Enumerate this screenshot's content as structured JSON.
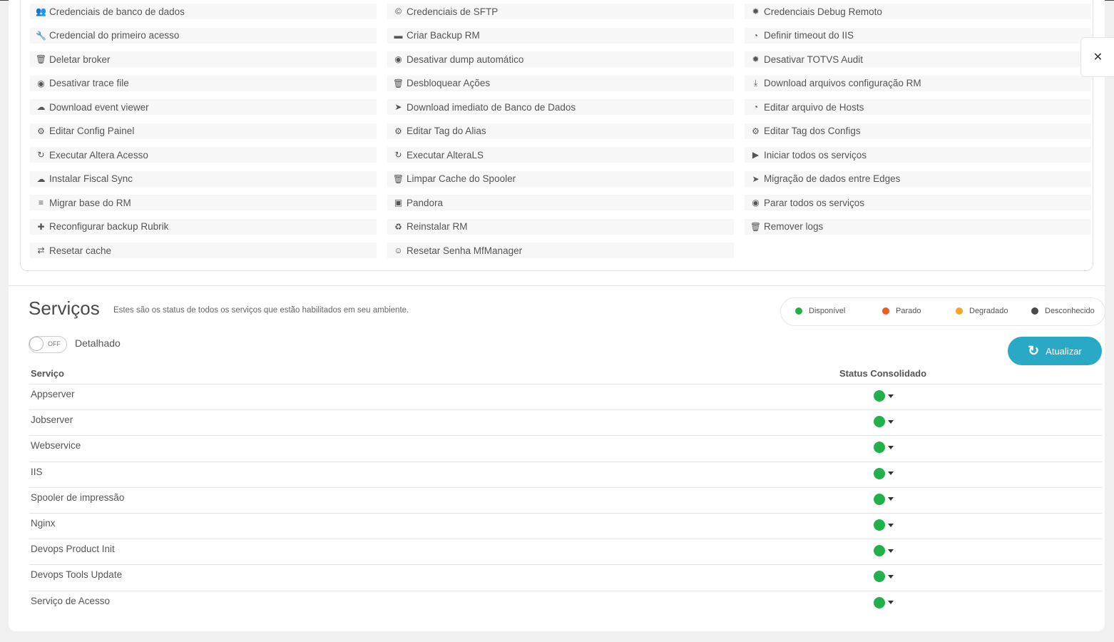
{
  "actions": {
    "col1": [
      {
        "label": "Credenciais de banco de dados",
        "icon": "users-icon"
      },
      {
        "label": "Credencial do primeiro acesso",
        "icon": "wrench-icon"
      },
      {
        "label": "Deletar broker",
        "icon": "trash-icon"
      },
      {
        "label": "Desativar trace file",
        "icon": "circle-icon"
      },
      {
        "label": "Download event viewer",
        "icon": "cloud-download-icon"
      },
      {
        "label": "Editar Config Painel",
        "icon": "gear-icon"
      },
      {
        "label": "Executar Altera Acesso",
        "icon": "refresh-icon"
      },
      {
        "label": "Instalar Fiscal Sync",
        "icon": "cloud-icon"
      },
      {
        "label": "Migrar base do RM",
        "icon": "database-icon"
      },
      {
        "label": "Reconfigurar backup Rubrik",
        "icon": "puzzle-icon"
      },
      {
        "label": "Resetar cache",
        "icon": "sync-icon"
      }
    ],
    "col2": [
      {
        "label": "Credenciais de SFTP",
        "icon": "copyright-icon"
      },
      {
        "label": "Criar Backup RM",
        "icon": "folder-icon"
      },
      {
        "label": "Desativar dump automático",
        "icon": "circle-icon"
      },
      {
        "label": "Desbloquear Ações",
        "icon": "trash-icon"
      },
      {
        "label": "Download imediato de Banco de Dados",
        "icon": "rocket-icon"
      },
      {
        "label": "Editar Tag do Alias",
        "icon": "gear-icon"
      },
      {
        "label": "Executar AlteraLS",
        "icon": "refresh-icon"
      },
      {
        "label": "Limpar Cache do Spooler",
        "icon": "trash-icon"
      },
      {
        "label": "Pandora",
        "icon": "briefcase-icon"
      },
      {
        "label": "Reinstalar RM",
        "icon": "recycle-icon"
      },
      {
        "label": "Resetar Senha MfManager",
        "icon": "user-lock-icon"
      }
    ],
    "col3": [
      {
        "label": "Credenciais Debug Remoto",
        "icon": "bug-icon"
      },
      {
        "label": "Definir timeout do IIS",
        "icon": "clock-icon"
      },
      {
        "label": "Desativar TOTVS Audit",
        "icon": "bug-icon"
      },
      {
        "label": "Download arquivos configuração RM",
        "icon": "download-icon"
      },
      {
        "label": "Editar arquivo de Hosts",
        "icon": "clock-icon"
      },
      {
        "label": "Editar Tag dos Configs",
        "icon": "gear-icon"
      },
      {
        "label": "Iniciar todos os serviços",
        "icon": "play-circle-icon"
      },
      {
        "label": "Migração de dados entre Edges",
        "icon": "rocket-icon"
      },
      {
        "label": "Parar todos os serviços",
        "icon": "circle-icon"
      },
      {
        "label": "Remover logs",
        "icon": "trash-icon"
      }
    ]
  },
  "services": {
    "title": "Serviços",
    "description": "Estes são os status de todos os serviços que estão habilitados em seu ambiente.",
    "legend": [
      {
        "label": "Disponível",
        "color": "#22b04b"
      },
      {
        "label": "Parado",
        "color": "#f05a24"
      },
      {
        "label": "Degradado",
        "color": "#f5a623"
      },
      {
        "label": "Desconhecido",
        "color": "#4a4a4a"
      }
    ],
    "toggle": {
      "state": "OFF",
      "label": "Detalhado"
    },
    "refresh_label": "Atualizar",
    "table": {
      "col_service": "Serviço",
      "col_status": "Status Consolidado",
      "status_color": "#22b04b",
      "rows": [
        {
          "name": "Appserver",
          "status": "Disponível"
        },
        {
          "name": "Jobserver",
          "status": "Disponível"
        },
        {
          "name": "Webservice",
          "status": "Disponível"
        },
        {
          "name": "IIS",
          "status": "Disponível"
        },
        {
          "name": "Spooler de impressão",
          "status": "Disponível"
        },
        {
          "name": "Nginx",
          "status": "Disponível"
        },
        {
          "name": "Devops Product Init",
          "status": "Disponível"
        },
        {
          "name": "Devops Tools Update",
          "status": "Disponível"
        },
        {
          "name": "Serviço de Acesso",
          "status": "Disponível"
        }
      ]
    }
  }
}
